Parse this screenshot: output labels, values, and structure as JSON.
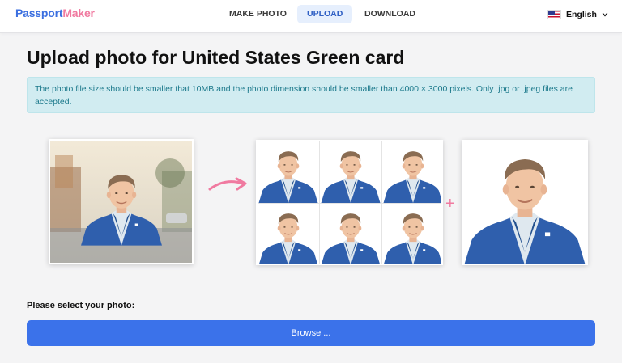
{
  "header": {
    "logo_part1": "Passport",
    "logo_part2": "Maker",
    "nav": [
      {
        "label": "MAKE PHOTO"
      },
      {
        "label": "UPLOAD"
      },
      {
        "label": "DOWNLOAD"
      }
    ],
    "active_nav": "UPLOAD",
    "language": "English",
    "language_flag": "us-flag-icon"
  },
  "main": {
    "title": "Upload photo for United States Green card",
    "notice": "The photo file size should be smaller that 10MB and the photo dimension should be smaller than 4000 × 3000 pixels. Only .jpg or .jpeg files are accepted.",
    "illustration": {
      "arrow_icon": "curved-arrow-icon",
      "plus_icon": "plus-icon",
      "grid_photo_count": 6
    },
    "select_label": "Please select your photo:",
    "browse_label": "Browse ..."
  },
  "colors": {
    "brand_blue": "#3b6fe0",
    "brand_pink": "#f07aa0",
    "button_blue": "#3b72ea",
    "notice_bg": "#d1ecf1",
    "notice_text": "#1d7a8c"
  }
}
